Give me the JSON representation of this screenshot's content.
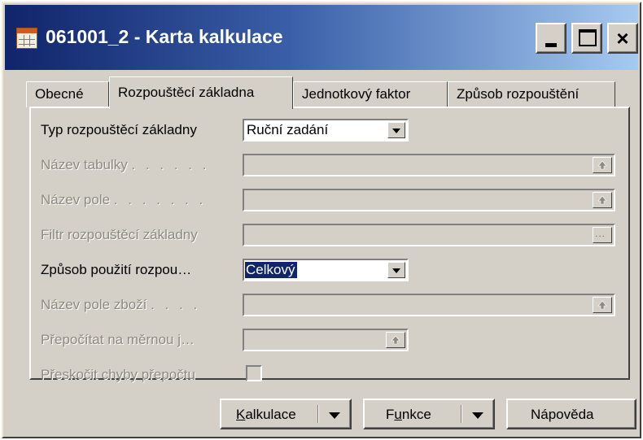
{
  "window": {
    "title": "061001_2 - Karta kalkulace",
    "icon": "table-form-icon",
    "controls": {
      "minimize": "minimize-icon",
      "maximize": "maximize-icon",
      "close": "×"
    }
  },
  "tabs": [
    {
      "label": "Obecné",
      "active": false
    },
    {
      "label": "Rozpouštěcí základna",
      "active": true
    },
    {
      "label": "Jednotkový faktor",
      "active": false
    },
    {
      "label": "Způsob rozpouštění",
      "active": false
    }
  ],
  "form": {
    "typ_rozpousteci_zakladny": {
      "label": "Typ rozpouštěcí základny",
      "value": "Ruční zadání",
      "enabled": true
    },
    "nazev_tabulky": {
      "label": "Název tabulky",
      "dots": ". . . . . .",
      "value": "",
      "enabled": false
    },
    "nazev_pole": {
      "label": "Název pole",
      "dots": ". . . . . . .",
      "value": "",
      "enabled": false
    },
    "filtr_rozpousteci_zakladny": {
      "label": "Filtr rozpouštěcí základny",
      "value": "",
      "lookup": "...",
      "enabled": false
    },
    "zpusob_pouziti": {
      "label": "Způsob použití rozpou…",
      "value": "Celkový",
      "enabled": true,
      "selected": true
    },
    "nazev_pole_zbozi": {
      "label": "Název pole zboží",
      "dots": ". . . .",
      "value": "",
      "enabled": false
    },
    "prepocitat": {
      "label": "Přepočítat na měrnou j…",
      "value": "",
      "enabled": false
    },
    "preskocit_chyby": {
      "label": "Přeskočit chyby přepočtu",
      "checked": false,
      "enabled": false
    }
  },
  "buttons": {
    "kalkulace": {
      "pre": "",
      "accel": "K",
      "post": "alkulace"
    },
    "funkce": {
      "pre": "F",
      "accel": "u",
      "post": "nkce"
    },
    "napoveda": {
      "label": "Nápověda"
    }
  },
  "colors": {
    "face": "#d4d0c8",
    "title_start": "#10246a",
    "title_end": "#a6caf0",
    "selection": "#10246a",
    "disabled_text": "#8d8a80"
  }
}
